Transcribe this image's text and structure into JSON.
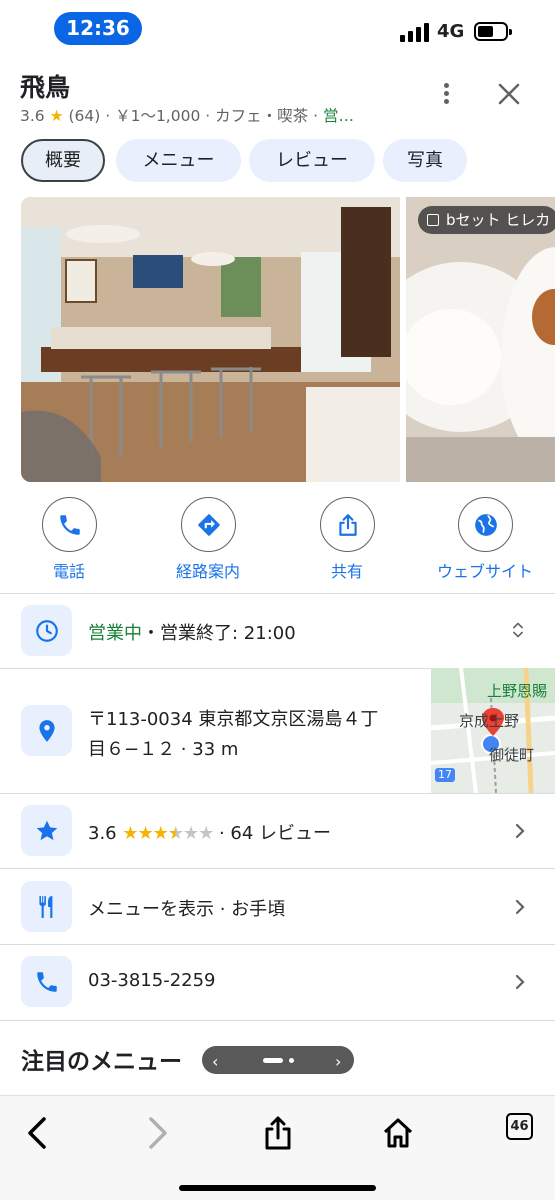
{
  "status_bar": {
    "time": "12:36",
    "network": "4G"
  },
  "place": {
    "name": "飛鳥",
    "rating": "3.6",
    "star": "★",
    "review_count": "(64)",
    "price": "￥1〜1,000",
    "category": "カフェ・喫茶",
    "status_short": "営…",
    "sep": "·"
  },
  "tabs": [
    {
      "label": "概要",
      "active": true
    },
    {
      "label": "メニュー",
      "active": false
    },
    {
      "label": "レビュー",
      "active": false
    },
    {
      "label": "写真",
      "active": false
    }
  ],
  "photos": {
    "second_tag": "bセット ヒレカ"
  },
  "actions": [
    {
      "label": "電話",
      "icon": "phone-icon"
    },
    {
      "label": "経路案内",
      "icon": "directions-icon"
    },
    {
      "label": "共有",
      "icon": "share-icon"
    },
    {
      "label": "ウェブサイト",
      "icon": "globe-icon"
    }
  ],
  "hours": {
    "open_label": "営業中",
    "rest": "・営業終了: 21:00"
  },
  "address": {
    "line1": "〒113-0034 東京都文京区湯島４丁",
    "line2": "目６−１２ · 33 m"
  },
  "map_labels": {
    "top": "上野恩賜",
    "station": "京成上野",
    "bottom": "御徒町",
    "route": "17"
  },
  "reviews_row": {
    "rating": "3.6",
    "stars_full": "★★★",
    "stars_half": "★",
    "stars_empty": "★★",
    "rest": "· 64 レビュー"
  },
  "menu_row": {
    "text": "メニューを表示 · お手頃"
  },
  "phone_row": {
    "text": "03-3815-2259"
  },
  "featured": {
    "title": "注目のメニュー"
  },
  "browser": {
    "tab_count": "46"
  },
  "colors": {
    "accent": "#1a73e8",
    "open_green": "#188038",
    "star": "#f5b400",
    "chip_bg": "#e8f0fe"
  }
}
